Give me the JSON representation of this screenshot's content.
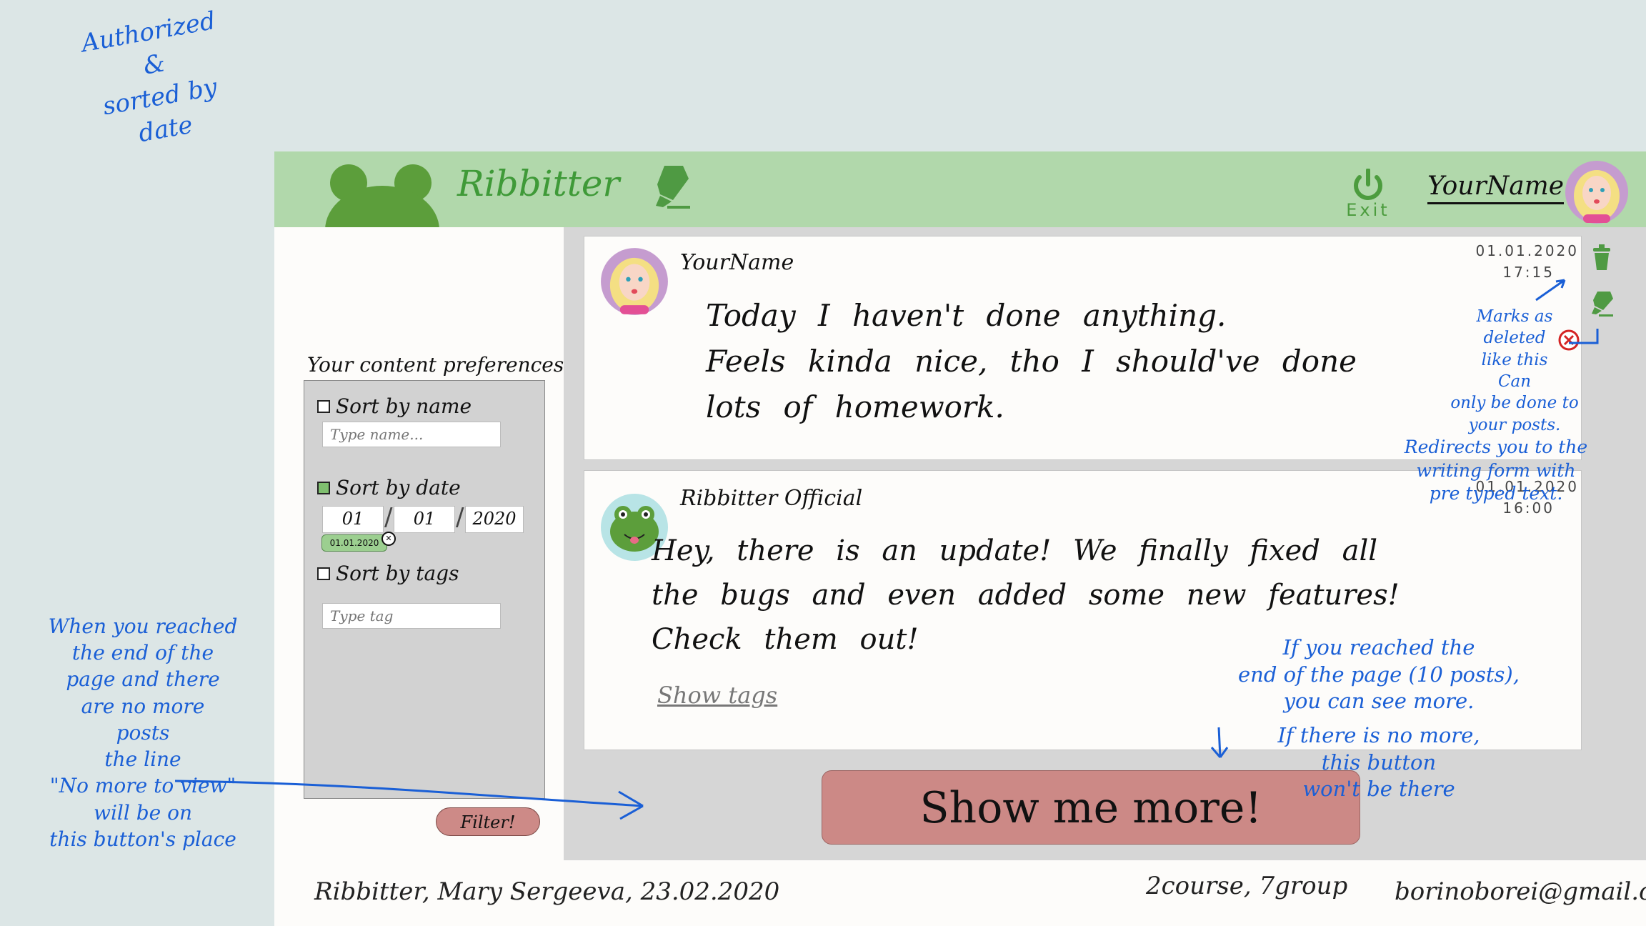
{
  "header": {
    "brand": "Ribbitter",
    "exit_label": "Exit",
    "username": "YourName"
  },
  "sidebar": {
    "prefs_title": "Your content preferences:",
    "sort_name": {
      "label": "Sort by name",
      "placeholder": "Type name...",
      "checked": false
    },
    "sort_date": {
      "label": "Sort by date",
      "day": "01",
      "month": "01",
      "year": "2020",
      "chip": "01.01.2020",
      "checked": true
    },
    "sort_tags": {
      "label": "Sort by tags",
      "placeholder": "Type tag",
      "checked": false
    },
    "filter_label": "Filter!"
  },
  "posts": [
    {
      "author": "YourName",
      "date": "01.01.2020",
      "time": "17:15",
      "text_lines": [
        "Today I haven't done anything.",
        "Feels kinda nice, tho I should've done",
        "lots of homework."
      ]
    },
    {
      "author": "Ribbitter Official",
      "date": "01.01.2020",
      "time": "16:00",
      "text_lines": [
        "Hey, there is an update! We finally fixed all",
        "the bugs and even added some new features!",
        "Check them out!"
      ],
      "show_tags": "Show tags"
    }
  ],
  "show_more_label": "Show me more!",
  "footer": {
    "left": "Ribbitter, Mary Sergeeva, 23.02.2020",
    "middle": "2course, 7group",
    "right": "borinoborei@gmail.com"
  },
  "annotations": {
    "top_left": [
      "Authorized",
      "&",
      "sorted by",
      "date"
    ],
    "marks_deleted": [
      "Marks as",
      "deleted",
      "like this",
      "Can",
      "only be done to",
      "your posts."
    ],
    "redirects": [
      "Redirects you to the",
      "writing form with",
      "pre typed text."
    ],
    "bottom_left": [
      "When you reached",
      "the end of the",
      "page and there",
      "are no more",
      "posts",
      "the line",
      "\"No more to view\"",
      "will be on",
      "this button's place"
    ],
    "right_bottom": [
      "If you reached the",
      "end of the page (10 posts),",
      "you can see more.",
      "If there is no more,",
      "this button",
      "won't be there"
    ]
  },
  "colors": {
    "header_bg": "#b1d8ab",
    "frog_green": "#5c9e3b",
    "button_red": "#cc8986",
    "annotation_blue": "#1a5fd6"
  }
}
